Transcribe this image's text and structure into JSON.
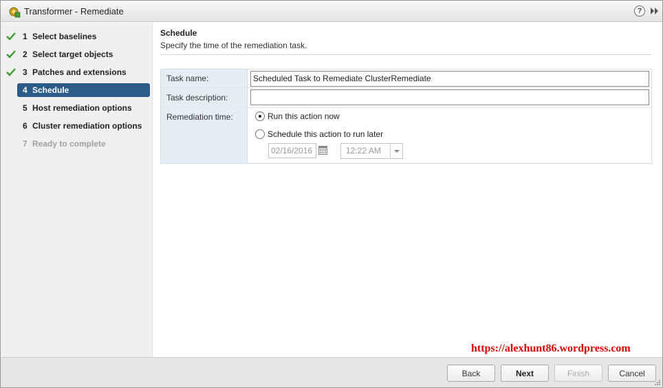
{
  "window": {
    "title": "Transformer - Remediate",
    "help_label": "?"
  },
  "steps": [
    {
      "num": "1",
      "label": "Select baselines",
      "state": "done"
    },
    {
      "num": "2",
      "label": "Select target objects",
      "state": "done"
    },
    {
      "num": "3",
      "label": "Patches and extensions",
      "state": "done"
    },
    {
      "num": "4",
      "label": "Schedule",
      "state": "current"
    },
    {
      "num": "5",
      "label": "Host remediation options",
      "state": "pending"
    },
    {
      "num": "6",
      "label": "Cluster remediation options",
      "state": "pending"
    },
    {
      "num": "7",
      "label": "Ready to complete",
      "state": "disabled"
    }
  ],
  "section": {
    "title": "Schedule",
    "description": "Specify the time of the remediation task."
  },
  "form": {
    "task_name_label": "Task name:",
    "task_name_value": "Scheduled Task to Remediate ClusterRemediate",
    "task_description_label": "Task description:",
    "task_description_value": "",
    "remediation_time_label": "Remediation time:",
    "option_now": "Run this action now",
    "option_later": "Schedule this action to run later",
    "selected_option": "now",
    "date_value": "02/16/2016",
    "time_value": "12:22 AM"
  },
  "watermark": "https://alexhunt86.wordpress.com",
  "footer": {
    "back": "Back",
    "next": "Next",
    "finish": "Finish",
    "cancel": "Cancel"
  },
  "colors": {
    "current_step_bg": "#2c5b88",
    "check_green": "#3a9b2e",
    "watermark_red": "#e10000"
  }
}
